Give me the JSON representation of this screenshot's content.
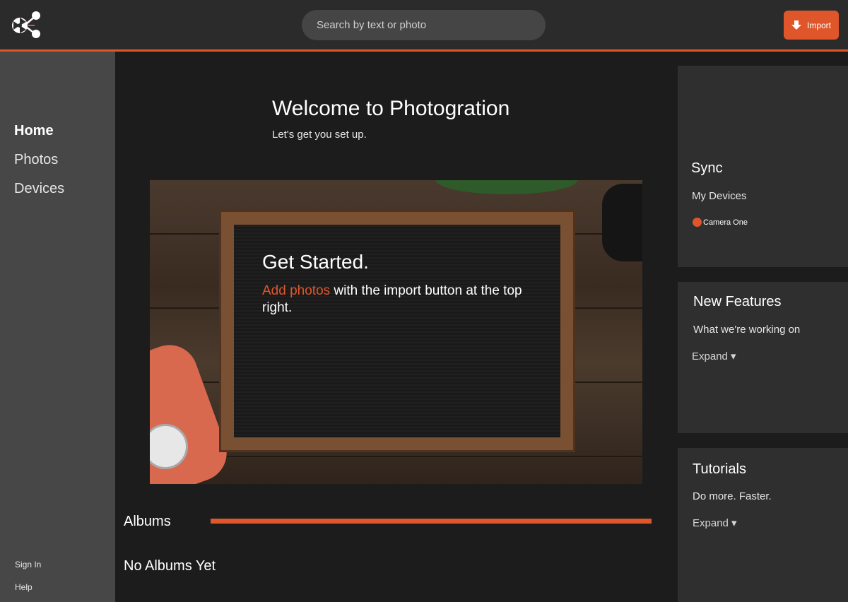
{
  "header": {
    "logo_icon": "photogration-logo-icon",
    "search_placeholder": "Search by text or photo",
    "import_label": "Import",
    "import_icon": "download-arrow-icon",
    "accent_color": "#e0562b"
  },
  "sidebar": {
    "items": [
      {
        "label": "Home",
        "active": true
      },
      {
        "label": "Photos",
        "active": false
      },
      {
        "label": "Devices",
        "active": false
      }
    ],
    "footer": {
      "sign_in": "Sign In",
      "help": "Help"
    }
  },
  "main": {
    "welcome_title": "Welcome to Photogration",
    "welcome_subtitle": "Let's get you set up.",
    "hero": {
      "title": "Get Started.",
      "link_text": "Add photos",
      "text_after_link": " with the import button at the top right."
    },
    "albums_label": "Albums",
    "albums_empty": "No Albums Yet"
  },
  "panels": {
    "sync": {
      "title": "Sync",
      "subtitle": "My Devices",
      "device": "Camera One",
      "device_status_color": "#e0562b"
    },
    "new_features": {
      "title": "New Features",
      "subtitle": "What we're working on",
      "expand": "Expand ▾"
    },
    "tutorials": {
      "title": "Tutorials",
      "subtitle": "Do more. Faster.",
      "expand": "Expand ▾"
    }
  }
}
